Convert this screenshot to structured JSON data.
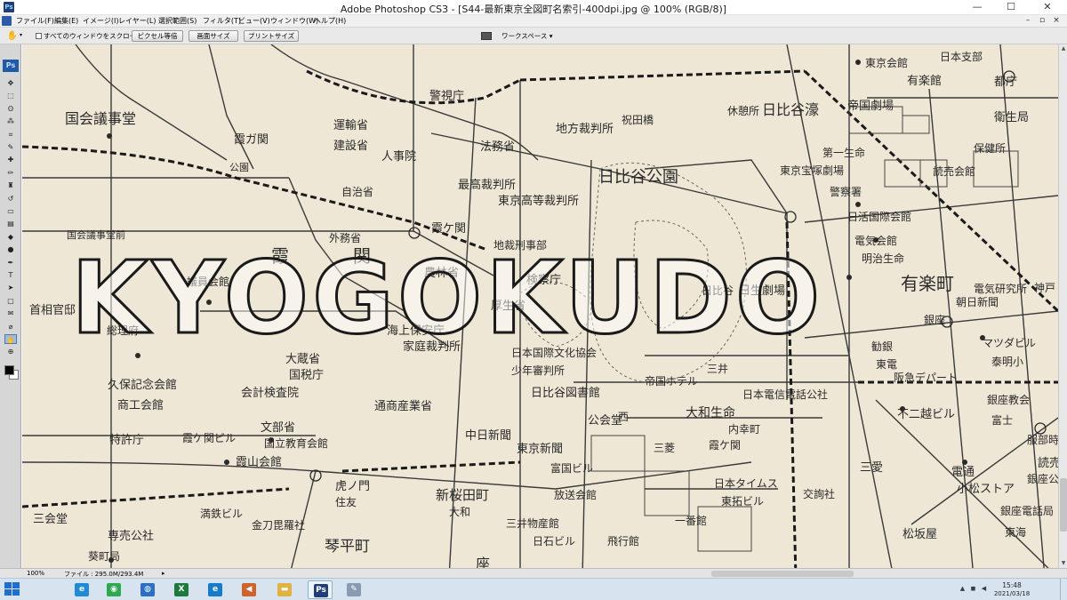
{
  "window": {
    "title": "Adobe Photoshop CS3 - [S44-最新東京全図町名索引-400dpi.jpg @ 100% (RGB/8)]",
    "minimize_glyph": "—",
    "maximize_glyph": "☐",
    "close_glyph": "✕"
  },
  "menubar": {
    "items": [
      {
        "label": "ファイル(F)"
      },
      {
        "label": "編集(E)"
      },
      {
        "label": "イメージ(I)"
      },
      {
        "label": "レイヤー(L)"
      },
      {
        "label": "選択範囲(S)"
      },
      {
        "label": "フィルタ(T)"
      },
      {
        "label": "ビュー(V)"
      },
      {
        "label": "ウィンドウ(W)"
      },
      {
        "label": "ヘルプ(H)"
      }
    ]
  },
  "options_bar": {
    "tool_icon": "hand-icon",
    "scroll_all_windows_label": "すべてのウィンドウをスクロール",
    "scroll_all_windows_checked": false,
    "buttons": [
      {
        "label": "ピクセル等倍"
      },
      {
        "label": "画面サイズ"
      },
      {
        "label": "プリントサイズ"
      }
    ],
    "workspace_label": "ワークスペース ▾"
  },
  "toolbox": {
    "logo": "Ps",
    "tools": [
      {
        "name": "move-tool-icon",
        "glyph": "✥"
      },
      {
        "name": "marquee-tool-icon",
        "glyph": "⬚"
      },
      {
        "name": "lasso-tool-icon",
        "glyph": "ʘ"
      },
      {
        "name": "magic-wand-tool-icon",
        "glyph": "⁂"
      },
      {
        "name": "crop-tool-icon",
        "glyph": "⌗"
      },
      {
        "name": "slice-tool-icon",
        "glyph": "✎"
      },
      {
        "name": "healing-brush-tool-icon",
        "glyph": "✚"
      },
      {
        "name": "brush-tool-icon",
        "glyph": "✏"
      },
      {
        "name": "clone-stamp-tool-icon",
        "glyph": "♜"
      },
      {
        "name": "history-brush-tool-icon",
        "glyph": "↺"
      },
      {
        "name": "eraser-tool-icon",
        "glyph": "▭"
      },
      {
        "name": "gradient-tool-icon",
        "glyph": "▤"
      },
      {
        "name": "blur-tool-icon",
        "glyph": "◆"
      },
      {
        "name": "dodge-tool-icon",
        "glyph": "●"
      },
      {
        "name": "pen-tool-icon",
        "glyph": "✒"
      },
      {
        "name": "type-tool-icon",
        "glyph": "T"
      },
      {
        "name": "path-selection-tool-icon",
        "glyph": "➤"
      },
      {
        "name": "shape-tool-icon",
        "glyph": "▢"
      },
      {
        "name": "notes-tool-icon",
        "glyph": "✉"
      },
      {
        "name": "eyedropper-tool-icon",
        "glyph": "⌀"
      },
      {
        "name": "hand-tool-icon",
        "glyph": "✋"
      },
      {
        "name": "zoom-tool-icon",
        "glyph": "⊕"
      }
    ],
    "active_tool": "hand-tool-icon",
    "foreground_color": "#000000",
    "background_color": "#ffffff"
  },
  "canvas": {
    "watermark": "KYOGOKUDO",
    "map_labels": [
      {
        "text": "国会議事堂"
      },
      {
        "text": "国会議事堂前"
      },
      {
        "text": "首相官邸"
      },
      {
        "text": "総理府"
      },
      {
        "text": "議員会館"
      },
      {
        "text": "霞ガ関"
      },
      {
        "text": "霞"
      },
      {
        "text": "関"
      },
      {
        "text": "公園"
      },
      {
        "text": "運輸省"
      },
      {
        "text": "建設省"
      },
      {
        "text": "人事院"
      },
      {
        "text": "自治省"
      },
      {
        "text": "外務省"
      },
      {
        "text": "警視庁"
      },
      {
        "text": "法務省"
      },
      {
        "text": "地方裁判所"
      },
      {
        "text": "最高裁判所"
      },
      {
        "text": "東京高等裁判所"
      },
      {
        "text": "霞ケ関"
      },
      {
        "text": "地裁刑事部"
      },
      {
        "text": "検察庁"
      },
      {
        "text": "農林省"
      },
      {
        "text": "厚生省"
      },
      {
        "text": "海上保安庁"
      },
      {
        "text": "家庭裁判所"
      },
      {
        "text": "大蔵省"
      },
      {
        "text": "国税庁"
      },
      {
        "text": "会計検査院"
      },
      {
        "text": "久保記念会館"
      },
      {
        "text": "商工会館"
      },
      {
        "text": "特許庁"
      },
      {
        "text": "霞ケ関ビル"
      },
      {
        "text": "文部省"
      },
      {
        "text": "国立教育会館"
      },
      {
        "text": "霞山会館"
      },
      {
        "text": "通商産業省"
      },
      {
        "text": "日本国際文化協会"
      },
      {
        "text": "少年審判所"
      },
      {
        "text": "日比谷図書館"
      },
      {
        "text": "日比谷公園"
      },
      {
        "text": "公会堂"
      },
      {
        "text": "中日新聞"
      },
      {
        "text": "東京新聞"
      },
      {
        "text": "富国ビル"
      },
      {
        "text": "新桜田町"
      },
      {
        "text": "大和"
      },
      {
        "text": "放送会館"
      },
      {
        "text": "三井物産館"
      },
      {
        "text": "日石ビル"
      },
      {
        "text": "飛行館"
      },
      {
        "text": "虎ノ門"
      },
      {
        "text": "住友"
      },
      {
        "text": "満鉄ビル"
      },
      {
        "text": "金刀毘羅社"
      },
      {
        "text": "琴平町"
      },
      {
        "text": "三会堂"
      },
      {
        "text": "専売公社"
      },
      {
        "text": "葵町局"
      },
      {
        "text": "祝田橋"
      },
      {
        "text": "休憩所"
      },
      {
        "text": "日比谷濠"
      },
      {
        "text": "東京会館"
      },
      {
        "text": "有楽館"
      },
      {
        "text": "帝国劇場"
      },
      {
        "text": "日本支部"
      },
      {
        "text": "都庁"
      },
      {
        "text": "衛生局"
      },
      {
        "text": "保健所"
      },
      {
        "text": "読売会館"
      },
      {
        "text": "第一生命"
      },
      {
        "text": "警察署"
      },
      {
        "text": "日活国際会館"
      },
      {
        "text": "電気会館"
      },
      {
        "text": "明治生命"
      },
      {
        "text": "有楽町"
      },
      {
        "text": "電気研究所"
      },
      {
        "text": "朝日新聞"
      },
      {
        "text": "銀座"
      },
      {
        "text": "東京宝塚劇場"
      },
      {
        "text": "日比谷"
      },
      {
        "text": "日生劇場"
      },
      {
        "text": "三井"
      },
      {
        "text": "帝国ホテル"
      },
      {
        "text": "日本電信電話公社"
      },
      {
        "text": "大和生命"
      },
      {
        "text": "内幸町"
      },
      {
        "text": "霞ケ関"
      },
      {
        "text": "日本タイムス"
      },
      {
        "text": "東拓ビル"
      },
      {
        "text": "三菱"
      },
      {
        "text": "一番館"
      },
      {
        "text": "勧銀"
      },
      {
        "text": "東電"
      },
      {
        "text": "阪急デパート"
      },
      {
        "text": "マツダビル"
      },
      {
        "text": "泰明小"
      },
      {
        "text": "銀座教会"
      },
      {
        "text": "富士"
      },
      {
        "text": "服部時計店"
      },
      {
        "text": "不二越ビル"
      },
      {
        "text": "三愛"
      },
      {
        "text": "銀座公証役場"
      },
      {
        "text": "電通"
      },
      {
        "text": "小松ストア"
      },
      {
        "text": "交詢社"
      },
      {
        "text": "銀座電話局"
      },
      {
        "text": "松坂屋"
      },
      {
        "text": "東海"
      },
      {
        "text": "神戸"
      },
      {
        "text": "読売新聞"
      },
      {
        "text": "座"
      },
      {
        "text": "西"
      }
    ]
  },
  "statusbar": {
    "zoom": "100%",
    "file_info": "ファイル : 295.0M/293.4M",
    "arrow": "▸"
  },
  "taskbar": {
    "apps": [
      {
        "name": "internet-explorer-icon",
        "glyph": "e",
        "color": "#1f8ad6"
      },
      {
        "name": "chrome-icon",
        "glyph": "◉",
        "color": "#2fa84f"
      },
      {
        "name": "firefox-like-icon",
        "glyph": "◍",
        "color": "#2b6fc2"
      },
      {
        "name": "excel-icon",
        "glyph": "X",
        "color": "#1d7a3d"
      },
      {
        "name": "edge-icon",
        "glyph": "e",
        "color": "#157ccc"
      },
      {
        "name": "speaker-app-icon",
        "glyph": "◀",
        "color": "#d0632a"
      },
      {
        "name": "folder-icon",
        "glyph": "▬",
        "color": "#e0b240"
      },
      {
        "name": "photoshop-icon",
        "glyph": "Ps",
        "color": "#1e3f7a"
      },
      {
        "name": "paint-icon",
        "glyph": "✎",
        "color": "#8a9bb0"
      }
    ],
    "clock_time": "15:48",
    "clock_date": "2021/03/18"
  }
}
